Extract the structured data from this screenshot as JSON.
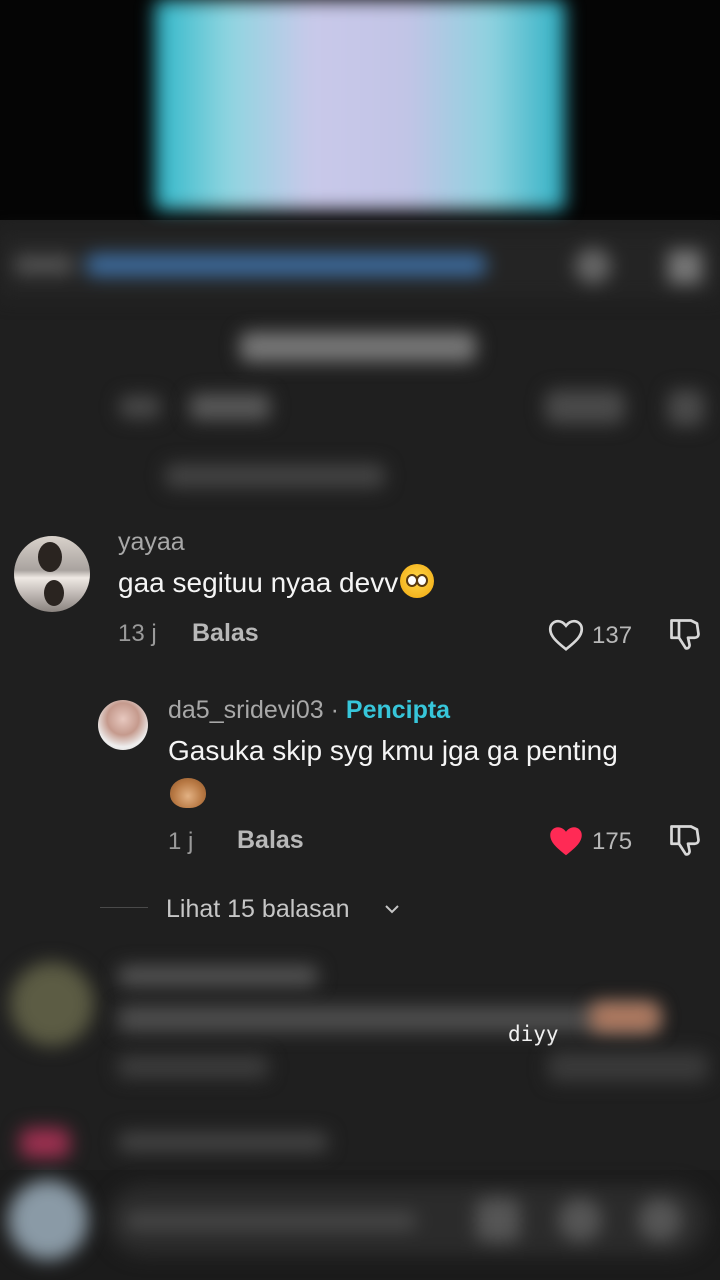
{
  "colors": {
    "background": "#1f1f1f",
    "creator_accent": "#37c6da",
    "like_active": "#ff2a55"
  },
  "comments": [
    {
      "username": "yayaa",
      "text": "gaa segituu nyaa devv",
      "emoji": "flushed-face",
      "time": "13 j",
      "reply_label": "Balas",
      "likes": "137",
      "liked": false
    }
  ],
  "reply": {
    "username": "da5_sridevi03",
    "separator": " · ",
    "creator_label": "Pencipta",
    "text": "Gasuka skip syg kmu jga ga penting",
    "emoji": "see-no-evil-monkey",
    "time": "1 j",
    "reply_label": "Balas",
    "likes": "175",
    "liked": true
  },
  "view_replies": {
    "label": "Lihat 15 balasan"
  },
  "watermark": "diyy"
}
